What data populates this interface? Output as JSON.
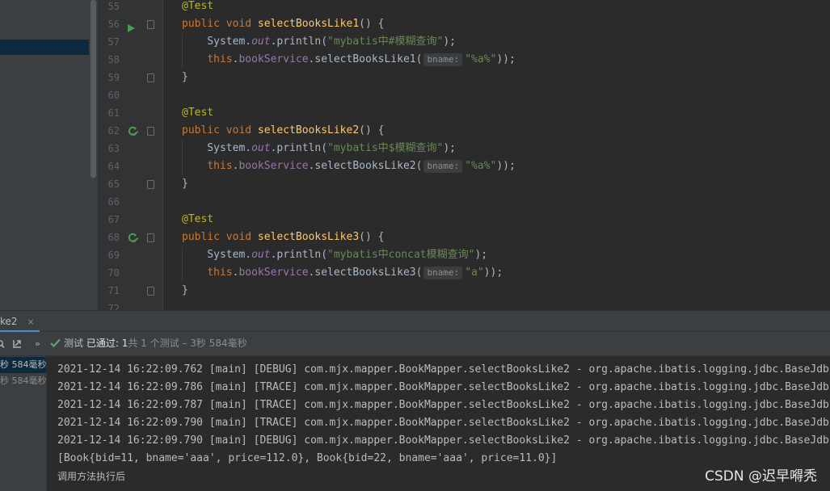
{
  "editor": {
    "lines": [
      {
        "num": "55",
        "segments": [
          {
            "t": "@Test",
            "c": "ann"
          }
        ]
      },
      {
        "num": "56",
        "gutter": "run",
        "segments": [
          {
            "t": "public void ",
            "c": "kw"
          },
          {
            "t": "selectBooksLike1",
            "c": "fn"
          },
          {
            "t": "() {",
            "c": "plain"
          }
        ]
      },
      {
        "num": "57",
        "segments": [
          {
            "t": "    System.",
            "c": "plain"
          },
          {
            "t": "out",
            "c": "fld"
          },
          {
            "t": ".println(",
            "c": "plain"
          },
          {
            "t": "\"mybatis中#模糊查询\"",
            "c": "str"
          },
          {
            "t": ");",
            "c": "plain"
          }
        ]
      },
      {
        "num": "58",
        "segments": [
          {
            "t": "    ",
            "c": "plain"
          },
          {
            "t": "this",
            "c": "kw"
          },
          {
            "t": ".",
            "c": "plain"
          },
          {
            "t": "bookService",
            "c": "fld2"
          },
          {
            "t": ".selectBooksLike1(",
            "c": "plain"
          },
          {
            "t": "bname:",
            "c": "hint"
          },
          {
            "t": "\"%a%\"",
            "c": "str"
          },
          {
            "t": "));",
            "c": "plain"
          }
        ]
      },
      {
        "num": "59",
        "segments": [
          {
            "t": "}",
            "c": "plain"
          }
        ]
      },
      {
        "num": "60",
        "segments": []
      },
      {
        "num": "61",
        "segments": [
          {
            "t": "@Test",
            "c": "ann"
          }
        ]
      },
      {
        "num": "62",
        "gutter": "rerun",
        "segments": [
          {
            "t": "public void ",
            "c": "kw"
          },
          {
            "t": "selectBooksLike2",
            "c": "fn"
          },
          {
            "t": "() {",
            "c": "plain"
          }
        ]
      },
      {
        "num": "63",
        "segments": [
          {
            "t": "    System.",
            "c": "plain"
          },
          {
            "t": "out",
            "c": "fld"
          },
          {
            "t": ".println(",
            "c": "plain"
          },
          {
            "t": "\"mybatis中$模糊查询\"",
            "c": "str"
          },
          {
            "t": ");",
            "c": "plain"
          }
        ]
      },
      {
        "num": "64",
        "segments": [
          {
            "t": "    ",
            "c": "plain"
          },
          {
            "t": "this",
            "c": "kw"
          },
          {
            "t": ".",
            "c": "plain"
          },
          {
            "t": "bookService",
            "c": "fld2"
          },
          {
            "t": ".selectBooksLike2(",
            "c": "plain"
          },
          {
            "t": "bname:",
            "c": "hint"
          },
          {
            "t": "\"%a%\"",
            "c": "str"
          },
          {
            "t": "));",
            "c": "plain"
          }
        ]
      },
      {
        "num": "65",
        "segments": [
          {
            "t": "}",
            "c": "plain"
          }
        ]
      },
      {
        "num": "66",
        "segments": []
      },
      {
        "num": "67",
        "segments": [
          {
            "t": "@Test",
            "c": "ann"
          }
        ]
      },
      {
        "num": "68",
        "gutter": "rerun",
        "segments": [
          {
            "t": "public void ",
            "c": "kw"
          },
          {
            "t": "selectBooksLike3",
            "c": "fn"
          },
          {
            "t": "() {",
            "c": "plain"
          }
        ]
      },
      {
        "num": "69",
        "segments": [
          {
            "t": "    System.",
            "c": "plain"
          },
          {
            "t": "out",
            "c": "fld"
          },
          {
            "t": ".println(",
            "c": "plain"
          },
          {
            "t": "\"mybatis中concat模糊查询\"",
            "c": "str"
          },
          {
            "t": ");",
            "c": "plain"
          }
        ]
      },
      {
        "num": "70",
        "segments": [
          {
            "t": "    ",
            "c": "plain"
          },
          {
            "t": "this",
            "c": "kw"
          },
          {
            "t": ".",
            "c": "plain"
          },
          {
            "t": "bookService",
            "c": "fld2"
          },
          {
            "t": ".selectBooksLike3(",
            "c": "plain"
          },
          {
            "t": "bname:",
            "c": "hint"
          },
          {
            "t": "\"a\"",
            "c": "str"
          },
          {
            "t": "));",
            "c": "plain"
          }
        ]
      },
      {
        "num": "71",
        "segments": [
          {
            "t": "}",
            "c": "plain"
          }
        ]
      },
      {
        "num": "72",
        "segments": []
      }
    ]
  },
  "run_panel": {
    "tab_label": "ke2",
    "tab_close": "×",
    "status": {
      "label": "测试",
      "passed": "已通过:",
      "count": "1",
      "detail": "共 1 个测试 – 3秒 584毫秒"
    },
    "tree": [
      {
        "label": "秒 584毫秒"
      },
      {
        "label": "秒 584毫秒"
      }
    ]
  },
  "console": {
    "lines": [
      "2021-12-14 16:22:09.762 [main] [DEBUG] com.mjx.mapper.BookMapper.selectBooksLike2 - org.apache.ibatis.logging.jdbc.BaseJdbcLogger",
      "2021-12-14 16:22:09.786 [main] [TRACE] com.mjx.mapper.BookMapper.selectBooksLike2 - org.apache.ibatis.logging.jdbc.BaseJdbcLogger",
      "2021-12-14 16:22:09.787 [main] [TRACE] com.mjx.mapper.BookMapper.selectBooksLike2 - org.apache.ibatis.logging.jdbc.BaseJdbcLogger",
      "2021-12-14 16:22:09.790 [main] [TRACE] com.mjx.mapper.BookMapper.selectBooksLike2 - org.apache.ibatis.logging.jdbc.BaseJdbcLogger",
      "2021-12-14 16:22:09.790 [main] [DEBUG] com.mjx.mapper.BookMapper.selectBooksLike2 - org.apache.ibatis.logging.jdbc.BaseJdbcLogger",
      "[Book{bid=11, bname='aaa', price=112.0}, Book{bid=22, bname='aaa', price=11.0}]",
      "调用方法执行后"
    ]
  },
  "watermark": "CSDN @迟早嘚秃",
  "colors": {
    "background": "#2b2b2b",
    "keyword": "#cc7832",
    "method": "#ffc66d",
    "string": "#6a8759",
    "annotation": "#bbb529",
    "field": "#9876aa",
    "pass_green": "#59a869"
  }
}
